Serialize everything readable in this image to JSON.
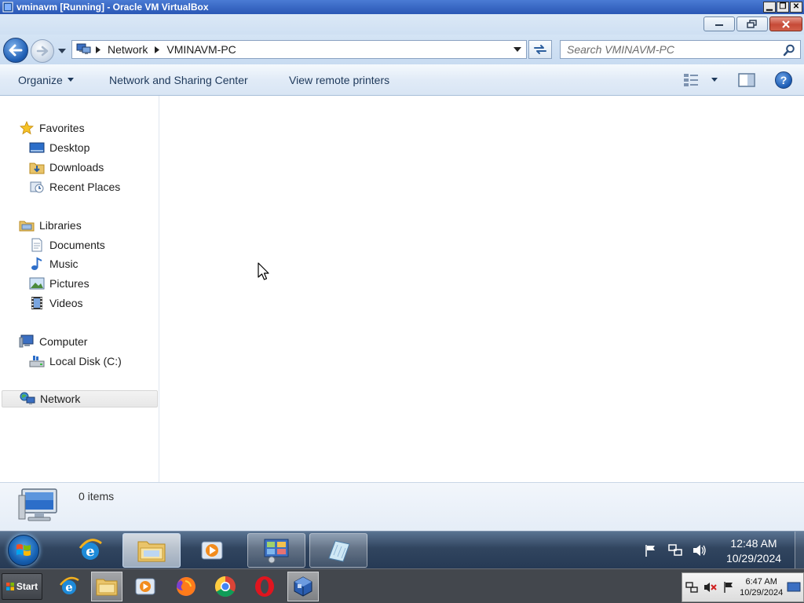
{
  "host_window": {
    "title": "vminavm [Running] - Oracle VM VirtualBox",
    "minimize_glyph": "▁",
    "restore_glyph": "❐",
    "close_glyph": "✕"
  },
  "explorer": {
    "breadcrumb": [
      "Network",
      "VMINAVM-PC"
    ],
    "search_placeholder": "Search VMINAVM-PC",
    "commands": {
      "organize": "Organize",
      "network_sharing_center": "Network and Sharing Center",
      "view_remote_printers": "View remote printers",
      "help": "?"
    },
    "nav_pane": {
      "favorites": {
        "label": "Favorites",
        "items": [
          "Desktop",
          "Downloads",
          "Recent Places"
        ]
      },
      "libraries": {
        "label": "Libraries",
        "items": [
          "Documents",
          "Music",
          "Pictures",
          "Videos"
        ]
      },
      "computer": {
        "label": "Computer",
        "items": [
          "Local Disk (C:)"
        ]
      },
      "network": {
        "label": "Network",
        "selected": true
      }
    },
    "details": {
      "item_count": "0 items"
    }
  },
  "guest_taskbar": {
    "clock_time": "12:48 AM",
    "clock_date": "10/29/2024",
    "pinned": [
      "internet-explorer",
      "windows-explorer",
      "media-player",
      "control-panel",
      "notepad"
    ]
  },
  "host_taskbar": {
    "start_label": "Start",
    "clock_time": "6:47 AM",
    "clock_date": "10/29/2024",
    "apps": [
      "internet-explorer",
      "file-explorer",
      "media-player",
      "firefox",
      "chrome",
      "opera",
      "virtualbox"
    ]
  },
  "colors": {
    "host_titlebar": "#2a57b5",
    "explorer_frame": "#cfe0f3",
    "guest_taskbar": "#31455f",
    "host_taskbar": "#43474d",
    "close_button": "#c64a37"
  }
}
